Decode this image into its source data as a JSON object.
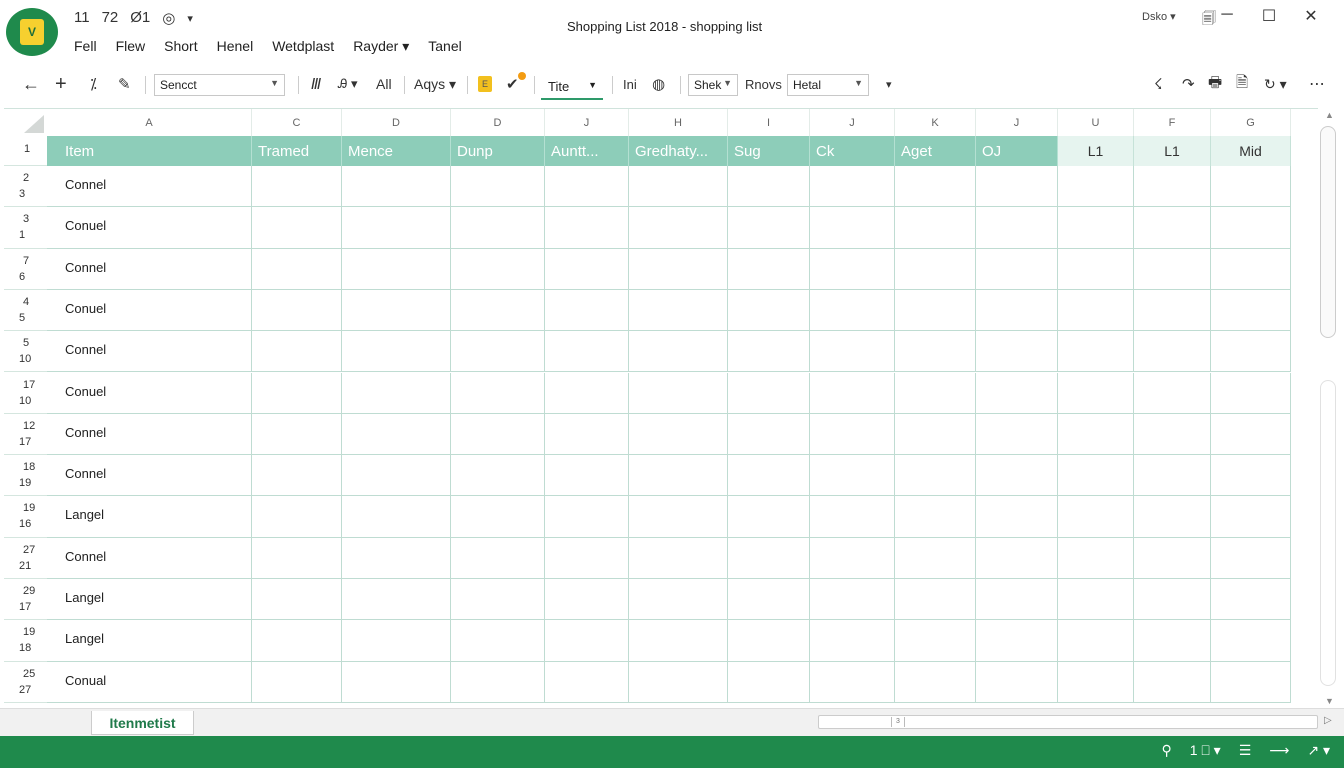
{
  "app": {
    "logo_letter": "V",
    "qat": [
      "11",
      "72",
      "Ø1",
      "◎",
      "▾"
    ],
    "menu": [
      "Fell",
      "Flew",
      "Short",
      "Henel",
      "Wetdplast",
      "Rayder ▾",
      "Tanel"
    ],
    "title": "Shopping List 2018 - shopping list",
    "account": "Dsko ▾",
    "window_controls": [
      "─",
      "☐",
      "✕"
    ],
    "window_icon": "🗐"
  },
  "toolbar": {
    "back": "←",
    "add": "+",
    "format_painter": "⁒",
    "pen": "✎",
    "select_dropdown": "Sencct",
    "italic": "Ⅲ",
    "person": "Ꭿ ▾",
    "all": "All",
    "angs": "Aqys ▾",
    "check": "✔",
    "file_tab": "Tite",
    "ins": "Ini",
    "shek_dropdown": "Shek",
    "rnovs": "Rnovs",
    "hetal_dropdown": "Hetal",
    "more_dropdown": "▾",
    "right_icons": [
      "☇",
      "↷",
      "🖶",
      "🗎",
      "↻ ▾",
      "⋯"
    ]
  },
  "sheet": {
    "column_letters": [
      "A",
      "C",
      "D",
      "D",
      "J",
      "H",
      "I",
      "J",
      "K",
      "J",
      "U",
      "F",
      "G"
    ],
    "header_row_number": "1",
    "headers": [
      "Item",
      "Tramed",
      "Mence",
      "Dunp",
      "Auntt...",
      "Gredhaty...",
      "Sug",
      "Ck",
      "Aget",
      "OJ",
      "L1",
      "L1",
      "Mid"
    ],
    "rows": [
      {
        "n1": "2",
        "n2": "3",
        "item": "Connel"
      },
      {
        "n1": "3",
        "n2": "1",
        "item": "Conuel"
      },
      {
        "n1": "7",
        "n2": "6",
        "item": "Connel"
      },
      {
        "n1": "4",
        "n2": "5",
        "item": "Conuel"
      },
      {
        "n1": "5",
        "n2": "10",
        "item": "Connel"
      },
      {
        "n1": "17",
        "n2": "10",
        "item": "Conuel"
      },
      {
        "n1": "12",
        "n2": "17",
        "item": "Connel"
      },
      {
        "n1": "18",
        "n2": "19",
        "item": "Connel"
      },
      {
        "n1": "19",
        "n2": "16",
        "item": "Langel"
      },
      {
        "n1": "27",
        "n2": "21",
        "item": "Connel"
      },
      {
        "n1": "29",
        "n2": "17",
        "item": "Langel"
      },
      {
        "n1": "19",
        "n2": "18",
        "item": "Langel"
      },
      {
        "n1": "25",
        "n2": "27",
        "item": "Conual"
      }
    ]
  },
  "tabs": {
    "sheet_tab": "Itenmetist",
    "hscroll_marker": "3",
    "hscroll_right": "▷"
  },
  "status": {
    "items": [
      "⚲",
      "1 ⎕ ▾",
      "☰",
      "⟶",
      "↗ ▾"
    ]
  },
  "colors": {
    "accent": "#1f8a4c",
    "header_fill": "#8dcdb9",
    "header_light": "#e6f4ef",
    "grid": "#bfdcd2"
  }
}
